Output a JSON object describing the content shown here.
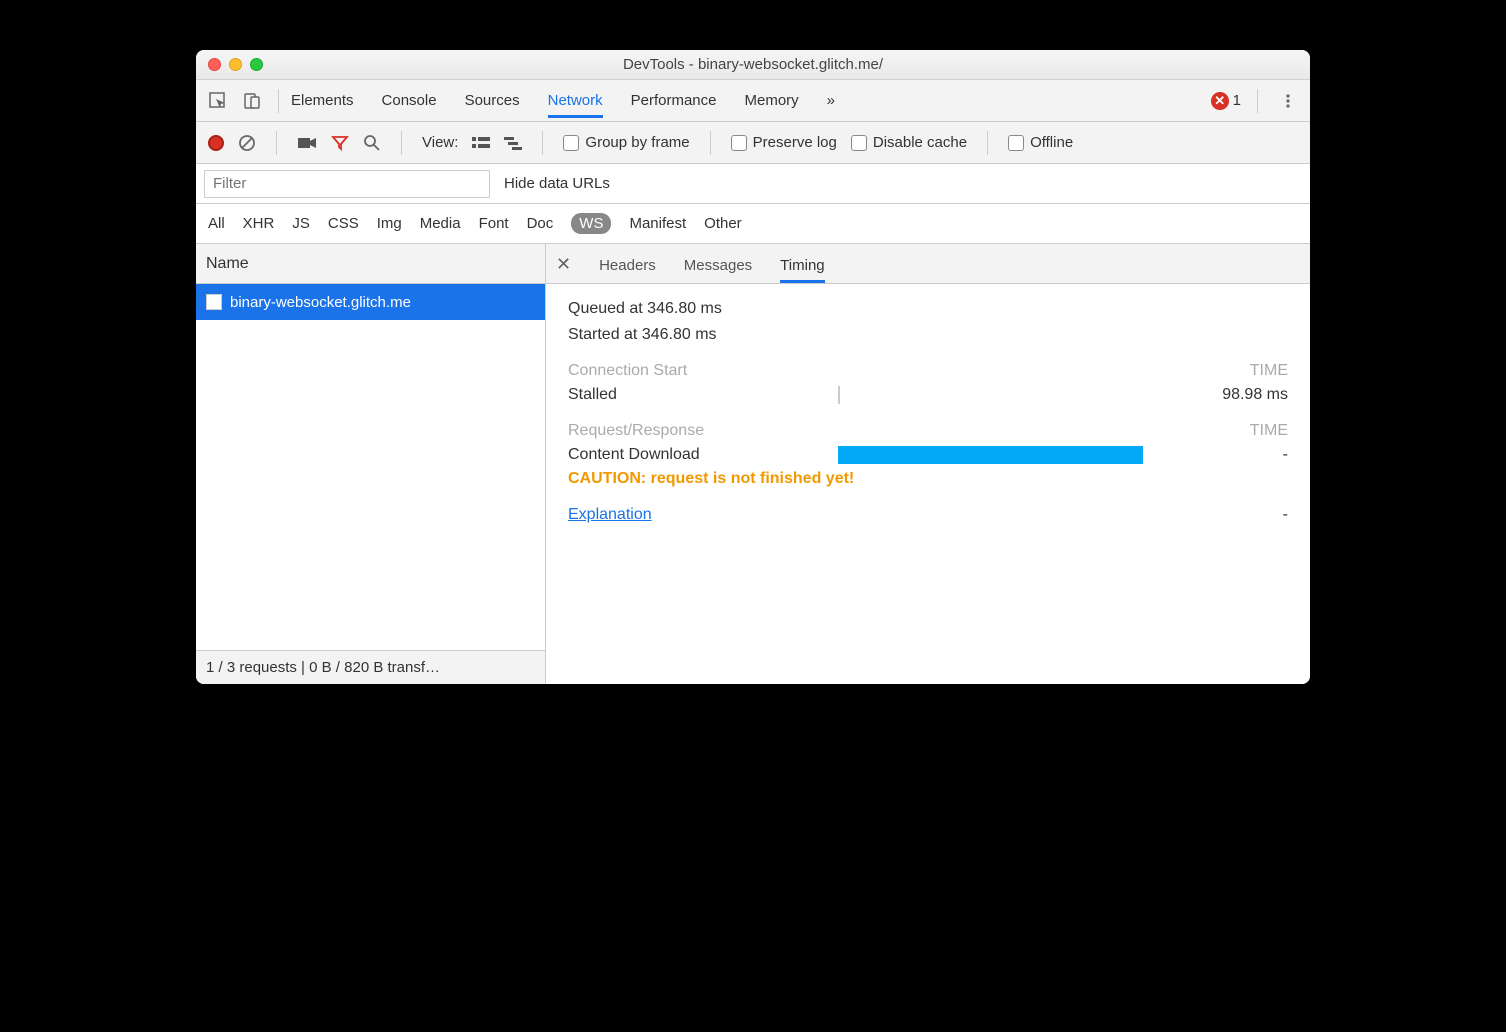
{
  "window_title": "DevTools - binary-websocket.glitch.me/",
  "tabs": {
    "items": [
      "Elements",
      "Console",
      "Sources",
      "Network",
      "Performance",
      "Memory"
    ],
    "active": "Network",
    "overflow": "»",
    "error_count": "1"
  },
  "toolbar": {
    "view_label": "View:",
    "group_by_frame": "Group by frame",
    "preserve_log": "Preserve log",
    "disable_cache": "Disable cache",
    "offline": "Offline"
  },
  "filter": {
    "placeholder": "Filter",
    "hide_data_urls": "Hide data URLs"
  },
  "filter_types": [
    "All",
    "XHR",
    "JS",
    "CSS",
    "Img",
    "Media",
    "Font",
    "Doc",
    "WS",
    "Manifest",
    "Other"
  ],
  "filter_selected": "WS",
  "left": {
    "header": "Name",
    "requests": [
      "binary-websocket.glitch.me"
    ],
    "status": "1 / 3 requests | 0 B / 820 B transf…"
  },
  "detail": {
    "tabs": [
      "Headers",
      "Messages",
      "Timing"
    ],
    "active": "Timing",
    "queued": "Queued at 346.80 ms",
    "started": "Started at 346.80 ms",
    "conn_head": "Connection Start",
    "time_head": "TIME",
    "stalled_label": "Stalled",
    "stalled_value": "98.98 ms",
    "rr_head": "Request/Response",
    "content_dl_label": "Content Download",
    "content_dl_value": "-",
    "caution": "CAUTION: request is not finished yet!",
    "explanation": "Explanation",
    "explanation_value": "-"
  }
}
